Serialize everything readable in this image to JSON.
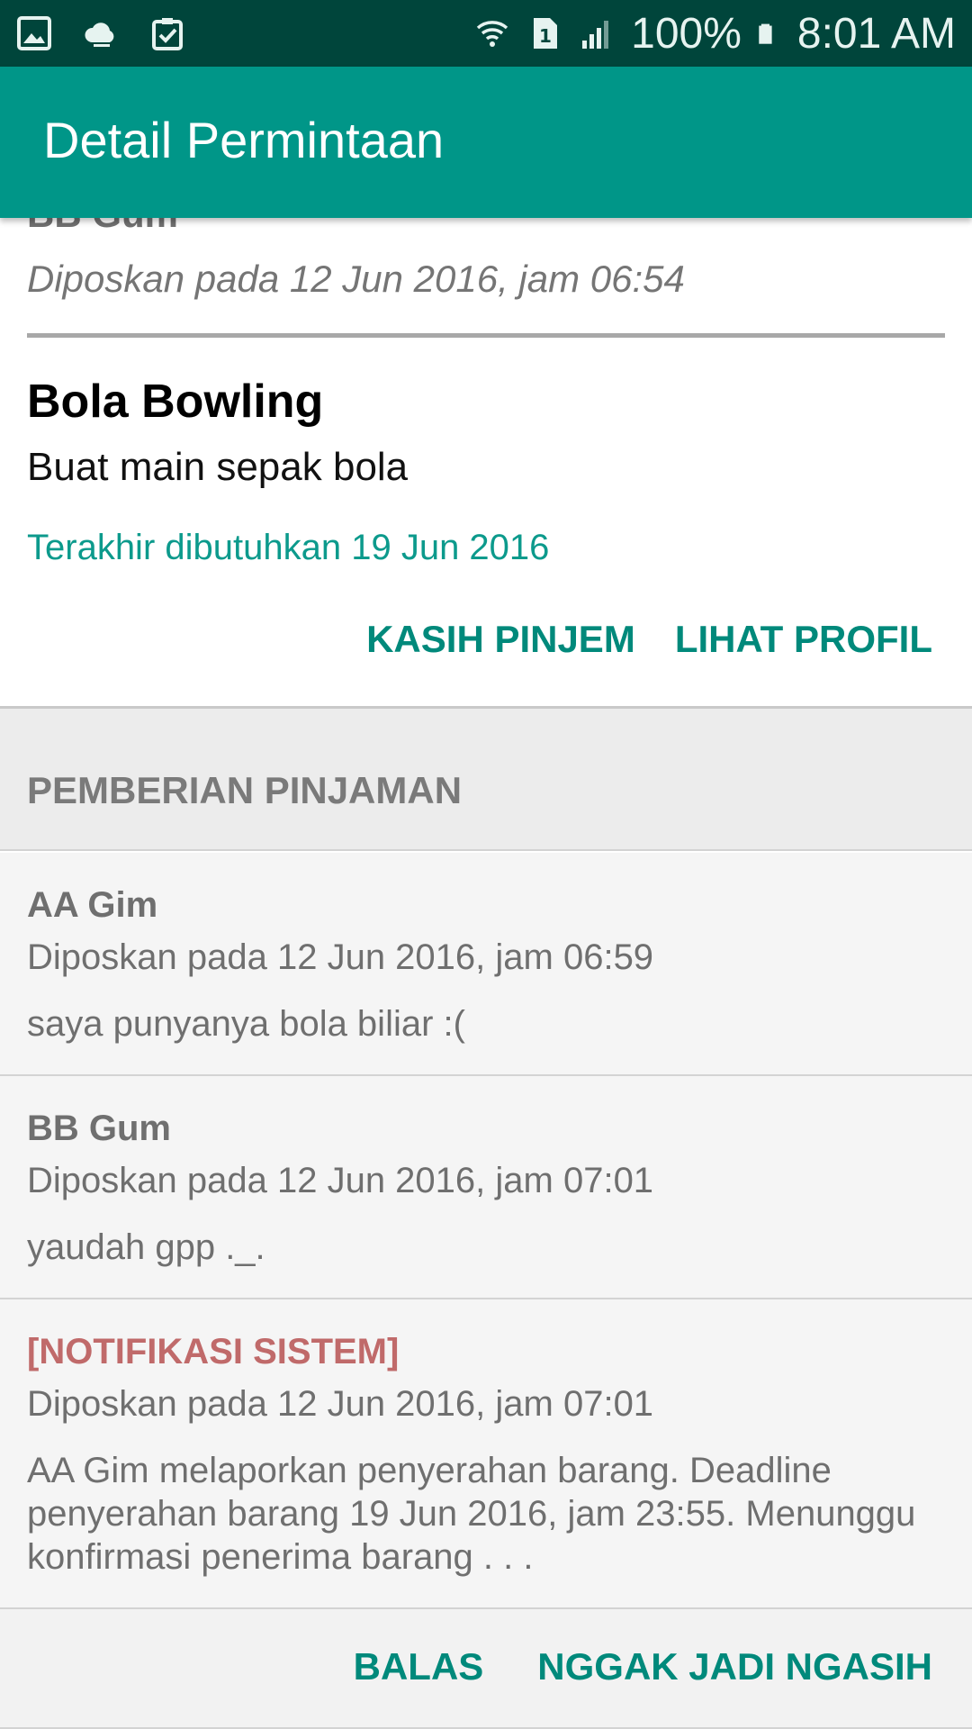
{
  "status_bar": {
    "left_icons": [
      "gallery-icon",
      "cloud-icon",
      "clipboard-check-icon"
    ],
    "right_icons": [
      "wifi-icon",
      "sim-icon",
      "signal-icon"
    ],
    "battery": "100%",
    "time": "8:01 AM"
  },
  "app_bar": {
    "title": "Detail Permintaan"
  },
  "request": {
    "user": "BB Gum",
    "posted": "Diposkan pada 12 Jun 2016, jam 06:54",
    "item": "Bola Bowling",
    "description": "Buat main sepak bola",
    "needed_until": "Terakhir dibutuhkan 19 Jun 2016",
    "actions": {
      "lend": "KASIH PINJEM",
      "view_profile": "LIHAT PROFIL"
    }
  },
  "section": {
    "title": "PEMBERIAN PINJAMAN"
  },
  "replies": [
    {
      "name": "AA Gim",
      "posted": "Diposkan pada 12 Jun 2016, jam 06:59",
      "message": "saya punyanya bola biliar :("
    },
    {
      "name": "BB Gum",
      "posted": "Diposkan pada 12 Jun 2016, jam 07:01",
      "message": "yaudah gpp ._."
    },
    {
      "name": "[NOTIFIKASI SISTEM]",
      "posted": "Diposkan pada 12 Jun 2016, jam 07:01",
      "message": "AA Gim melaporkan penyerahan barang. Deadline penyerahan barang 19 Jun 2016, jam 23:55. Menunggu konfirmasi penerima barang . . ."
    }
  ],
  "reply_actions": {
    "reply": "BALAS",
    "cancel_lend": "NGGAK JADI NGASIH"
  },
  "colors": {
    "status_bar": "#00453b",
    "app_bar": "#009688",
    "accent": "#00897b",
    "system_notice": "#c06a6a"
  }
}
